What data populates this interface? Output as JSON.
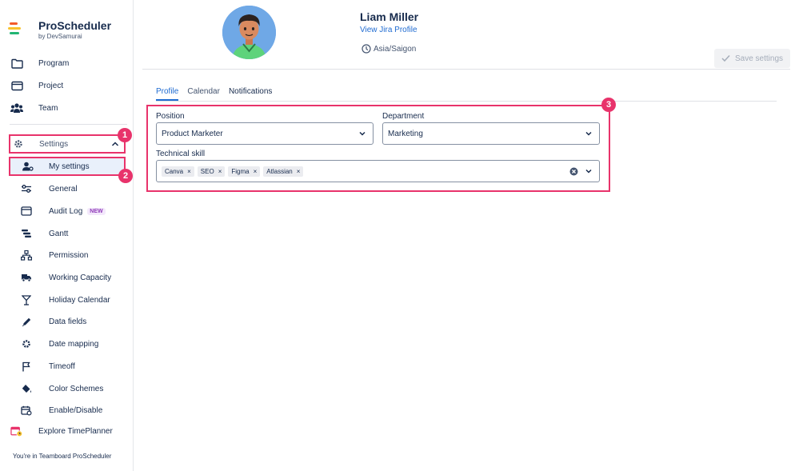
{
  "brand": {
    "title": "ProScheduler",
    "subtitle": "by DevSamurai"
  },
  "nav": [
    {
      "label": "Program",
      "icon": "folder-icon"
    },
    {
      "label": "Project",
      "icon": "browser-window-icon"
    },
    {
      "label": "Team",
      "icon": "team-icon"
    }
  ],
  "settings": {
    "label": "Settings",
    "icon": "gear-icon",
    "expanded": true
  },
  "my_settings": {
    "label": "My settings",
    "icon": "user-settings-icon"
  },
  "settings_items": [
    {
      "label": "General",
      "icon": "sliders-icon"
    },
    {
      "label": "Audit Log",
      "icon": "browser-window-icon",
      "badge": "NEW"
    },
    {
      "label": "Gantt",
      "icon": "gantt-icon"
    },
    {
      "label": "Permission",
      "icon": "hierarchy-icon"
    },
    {
      "label": "Working Capacity",
      "icon": "truck-icon"
    },
    {
      "label": "Holiday Calendar",
      "icon": "cocktail-icon"
    },
    {
      "label": "Data fields",
      "icon": "pencil-icon"
    },
    {
      "label": "Date mapping",
      "icon": "gear-icon"
    },
    {
      "label": "Timeoff",
      "icon": "flag-icon"
    },
    {
      "label": "Color Schemes",
      "icon": "paint-bucket-icon"
    },
    {
      "label": "Enable/Disable",
      "icon": "calendar-gear-icon"
    }
  ],
  "explore": {
    "label": "Explore TimePlanner",
    "icon": "calendar-clock-icon"
  },
  "footer": {
    "text": "You're in Teamboard ProScheduler"
  },
  "markers": [
    "1",
    "2",
    "3"
  ],
  "user": {
    "name": "Liam Miller",
    "jira_link": "View Jira Profile",
    "timezone": "Asia/Saigon"
  },
  "actions": {
    "save_label": "Save settings"
  },
  "tabs": [
    {
      "label": "Profile",
      "active": true
    },
    {
      "label": "Calendar",
      "active": false
    },
    {
      "label": "Notifications",
      "active": false
    }
  ],
  "form": {
    "position_label": "Position",
    "position_value": "Product Marketer",
    "department_label": "Department",
    "department_value": "Marketing",
    "skill_label": "Technical skill",
    "skills": [
      "Canva",
      "SEO",
      "Figma",
      "Atlassian"
    ]
  },
  "colors": {
    "accent": "#1f6bd1",
    "highlight": "#e8336b",
    "selected_bg": "#e9f0fb"
  }
}
